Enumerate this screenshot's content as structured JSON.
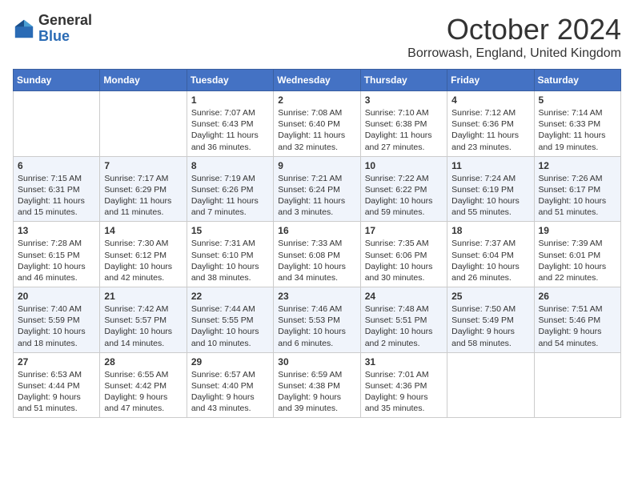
{
  "header": {
    "logo_general": "General",
    "logo_blue": "Blue",
    "month_title": "October 2024",
    "subtitle": "Borrowash, England, United Kingdom"
  },
  "days_of_week": [
    "Sunday",
    "Monday",
    "Tuesday",
    "Wednesday",
    "Thursday",
    "Friday",
    "Saturday"
  ],
  "weeks": [
    [
      {
        "day": "",
        "sunrise": "",
        "sunset": "",
        "daylight": ""
      },
      {
        "day": "",
        "sunrise": "",
        "sunset": "",
        "daylight": ""
      },
      {
        "day": "1",
        "sunrise": "Sunrise: 7:07 AM",
        "sunset": "Sunset: 6:43 PM",
        "daylight": "Daylight: 11 hours and 36 minutes."
      },
      {
        "day": "2",
        "sunrise": "Sunrise: 7:08 AM",
        "sunset": "Sunset: 6:40 PM",
        "daylight": "Daylight: 11 hours and 32 minutes."
      },
      {
        "day": "3",
        "sunrise": "Sunrise: 7:10 AM",
        "sunset": "Sunset: 6:38 PM",
        "daylight": "Daylight: 11 hours and 27 minutes."
      },
      {
        "day": "4",
        "sunrise": "Sunrise: 7:12 AM",
        "sunset": "Sunset: 6:36 PM",
        "daylight": "Daylight: 11 hours and 23 minutes."
      },
      {
        "day": "5",
        "sunrise": "Sunrise: 7:14 AM",
        "sunset": "Sunset: 6:33 PM",
        "daylight": "Daylight: 11 hours and 19 minutes."
      }
    ],
    [
      {
        "day": "6",
        "sunrise": "Sunrise: 7:15 AM",
        "sunset": "Sunset: 6:31 PM",
        "daylight": "Daylight: 11 hours and 15 minutes."
      },
      {
        "day": "7",
        "sunrise": "Sunrise: 7:17 AM",
        "sunset": "Sunset: 6:29 PM",
        "daylight": "Daylight: 11 hours and 11 minutes."
      },
      {
        "day": "8",
        "sunrise": "Sunrise: 7:19 AM",
        "sunset": "Sunset: 6:26 PM",
        "daylight": "Daylight: 11 hours and 7 minutes."
      },
      {
        "day": "9",
        "sunrise": "Sunrise: 7:21 AM",
        "sunset": "Sunset: 6:24 PM",
        "daylight": "Daylight: 11 hours and 3 minutes."
      },
      {
        "day": "10",
        "sunrise": "Sunrise: 7:22 AM",
        "sunset": "Sunset: 6:22 PM",
        "daylight": "Daylight: 10 hours and 59 minutes."
      },
      {
        "day": "11",
        "sunrise": "Sunrise: 7:24 AM",
        "sunset": "Sunset: 6:19 PM",
        "daylight": "Daylight: 10 hours and 55 minutes."
      },
      {
        "day": "12",
        "sunrise": "Sunrise: 7:26 AM",
        "sunset": "Sunset: 6:17 PM",
        "daylight": "Daylight: 10 hours and 51 minutes."
      }
    ],
    [
      {
        "day": "13",
        "sunrise": "Sunrise: 7:28 AM",
        "sunset": "Sunset: 6:15 PM",
        "daylight": "Daylight: 10 hours and 46 minutes."
      },
      {
        "day": "14",
        "sunrise": "Sunrise: 7:30 AM",
        "sunset": "Sunset: 6:12 PM",
        "daylight": "Daylight: 10 hours and 42 minutes."
      },
      {
        "day": "15",
        "sunrise": "Sunrise: 7:31 AM",
        "sunset": "Sunset: 6:10 PM",
        "daylight": "Daylight: 10 hours and 38 minutes."
      },
      {
        "day": "16",
        "sunrise": "Sunrise: 7:33 AM",
        "sunset": "Sunset: 6:08 PM",
        "daylight": "Daylight: 10 hours and 34 minutes."
      },
      {
        "day": "17",
        "sunrise": "Sunrise: 7:35 AM",
        "sunset": "Sunset: 6:06 PM",
        "daylight": "Daylight: 10 hours and 30 minutes."
      },
      {
        "day": "18",
        "sunrise": "Sunrise: 7:37 AM",
        "sunset": "Sunset: 6:04 PM",
        "daylight": "Daylight: 10 hours and 26 minutes."
      },
      {
        "day": "19",
        "sunrise": "Sunrise: 7:39 AM",
        "sunset": "Sunset: 6:01 PM",
        "daylight": "Daylight: 10 hours and 22 minutes."
      }
    ],
    [
      {
        "day": "20",
        "sunrise": "Sunrise: 7:40 AM",
        "sunset": "Sunset: 5:59 PM",
        "daylight": "Daylight: 10 hours and 18 minutes."
      },
      {
        "day": "21",
        "sunrise": "Sunrise: 7:42 AM",
        "sunset": "Sunset: 5:57 PM",
        "daylight": "Daylight: 10 hours and 14 minutes."
      },
      {
        "day": "22",
        "sunrise": "Sunrise: 7:44 AM",
        "sunset": "Sunset: 5:55 PM",
        "daylight": "Daylight: 10 hours and 10 minutes."
      },
      {
        "day": "23",
        "sunrise": "Sunrise: 7:46 AM",
        "sunset": "Sunset: 5:53 PM",
        "daylight": "Daylight: 10 hours and 6 minutes."
      },
      {
        "day": "24",
        "sunrise": "Sunrise: 7:48 AM",
        "sunset": "Sunset: 5:51 PM",
        "daylight": "Daylight: 10 hours and 2 minutes."
      },
      {
        "day": "25",
        "sunrise": "Sunrise: 7:50 AM",
        "sunset": "Sunset: 5:49 PM",
        "daylight": "Daylight: 9 hours and 58 minutes."
      },
      {
        "day": "26",
        "sunrise": "Sunrise: 7:51 AM",
        "sunset": "Sunset: 5:46 PM",
        "daylight": "Daylight: 9 hours and 54 minutes."
      }
    ],
    [
      {
        "day": "27",
        "sunrise": "Sunrise: 6:53 AM",
        "sunset": "Sunset: 4:44 PM",
        "daylight": "Daylight: 9 hours and 51 minutes."
      },
      {
        "day": "28",
        "sunrise": "Sunrise: 6:55 AM",
        "sunset": "Sunset: 4:42 PM",
        "daylight": "Daylight: 9 hours and 47 minutes."
      },
      {
        "day": "29",
        "sunrise": "Sunrise: 6:57 AM",
        "sunset": "Sunset: 4:40 PM",
        "daylight": "Daylight: 9 hours and 43 minutes."
      },
      {
        "day": "30",
        "sunrise": "Sunrise: 6:59 AM",
        "sunset": "Sunset: 4:38 PM",
        "daylight": "Daylight: 9 hours and 39 minutes."
      },
      {
        "day": "31",
        "sunrise": "Sunrise: 7:01 AM",
        "sunset": "Sunset: 4:36 PM",
        "daylight": "Daylight: 9 hours and 35 minutes."
      },
      {
        "day": "",
        "sunrise": "",
        "sunset": "",
        "daylight": ""
      },
      {
        "day": "",
        "sunrise": "",
        "sunset": "",
        "daylight": ""
      }
    ]
  ]
}
